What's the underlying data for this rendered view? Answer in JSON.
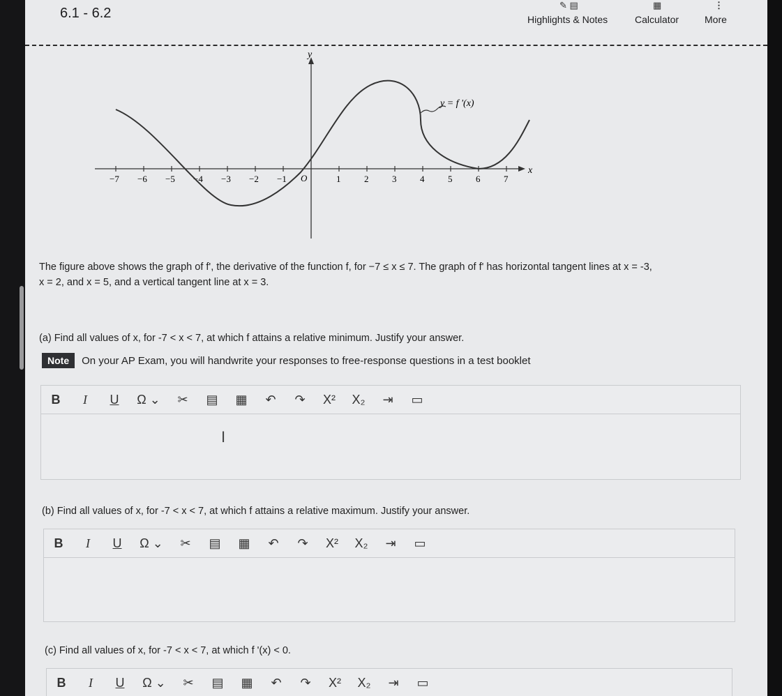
{
  "header": {
    "title": "6.1 - 6.2",
    "highlights_label": "Highlights & Notes",
    "calculator_label": "Calculator",
    "more_label": "More"
  },
  "graph": {
    "y_axis_label": "y",
    "x_axis_label": "x",
    "curve_label": "y = f '(x)",
    "origin_label": "O",
    "x_ticks": [
      "−7",
      "−6",
      "−5",
      "−4",
      "−3",
      "−2",
      "−1",
      "1",
      "2",
      "3",
      "4",
      "5",
      "6",
      "7"
    ]
  },
  "problem": {
    "intro_line1": "The figure above shows the graph of f', the derivative of the function f, for −7 ≤ x ≤ 7. The graph of f' has horizontal tangent lines at x = -3,",
    "intro_line2": "x = 2, and x = 5, and a vertical tangent line at x = 3.",
    "part_a": "(a) Find all values of x, for -7 < x < 7, at which f attains a relative minimum. Justify your answer.",
    "part_b": "(b) Find all values of x, for -7 < x < 7, at which f attains a relative maximum. Justify your answer.",
    "part_c": "(c) Find all values of x, for -7 < x < 7, at which f '(x) < 0."
  },
  "note": {
    "badge": "Note",
    "text": "On your AP Exam, you will handwrite your responses to free-response questions in a test booklet"
  },
  "toolbar": {
    "bold": "B",
    "italic": "I",
    "underline": "U",
    "special_char": "Ω ⌄",
    "cut": "✂",
    "superscript": "X²",
    "subscript": "X₂"
  }
}
